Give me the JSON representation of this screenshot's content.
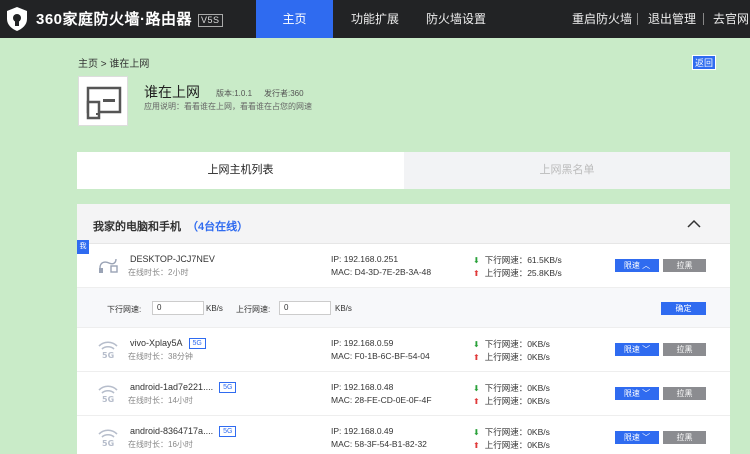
{
  "topbar": {
    "brand": "360家庭防火墙·路由器",
    "version": "V5S",
    "nav": [
      "主页",
      "功能扩展",
      "防火墙设置"
    ],
    "right_links": [
      "重启防火墙",
      "退出管理",
      "去官网"
    ]
  },
  "breadcrumb": {
    "home": "主页",
    "sep": ">",
    "current": "谁在上网"
  },
  "back_label": "返回",
  "app": {
    "title": "谁在上网",
    "version": "版本:1.0.1",
    "publisher": "发行者:360",
    "desc": "应用说明：看看谁在上网，看看谁在占您的网速"
  },
  "tabs": [
    "上网主机列表",
    "上网黑名单"
  ],
  "panel": {
    "title": "我家的电脑和手机",
    "online": "（4台在线）"
  },
  "corner_tag": "我",
  "devices": [
    {
      "name": "DESKTOP-JCJ7NEV",
      "badge": "",
      "time": "在线时长：2小时",
      "ip": "IP: 192.168.0.251",
      "mac": "MAC: D4-3D-7E-2B-3A-48",
      "down": "下行网速：61.5KB/s",
      "up": "上行网速：25.8KB/s",
      "icon": "wired-cable-icon"
    },
    {
      "name": "vivo-Xplay5A",
      "badge": "5G",
      "time": "在线时长：38分钟",
      "ip": "IP: 192.168.0.59",
      "mac": "MAC: F0-1B-6C-BF-54-04",
      "down": "下行网速：0KB/s",
      "up": "上行网速：0KB/s",
      "icon": "wifi-icon"
    },
    {
      "name": "android-1ad7e221....",
      "badge": "5G",
      "time": "在线时长：14小时",
      "ip": "IP: 192.168.0.48",
      "mac": "MAC: 28-FE-CD-0E-0F-4F",
      "down": "下行网速：0KB/s",
      "up": "上行网速：0KB/s",
      "icon": "wifi-icon"
    },
    {
      "name": "android-8364717a....",
      "badge": "5G",
      "time": "在线时长：16小时",
      "ip": "IP: 192.168.0.49",
      "mac": "MAC: 58-3F-54-B1-82-32",
      "down": "下行网速：0KB/s",
      "up": "上行网速：0KB/s",
      "icon": "wifi-icon"
    }
  ],
  "buttons": {
    "limit": "限速",
    "block": "拉黑",
    "ok": "确定"
  },
  "limit_row": {
    "down_label": "下行网速:",
    "up_label": "上行网速:",
    "down_value": "0",
    "up_value": "0",
    "unit": "KB/s"
  },
  "colors": {
    "accent": "#2f6bf0",
    "background": "#c9ebc8",
    "topbar": "#222325",
    "down_arrow": "#2aa13a",
    "up_arrow": "#e03a3a"
  }
}
